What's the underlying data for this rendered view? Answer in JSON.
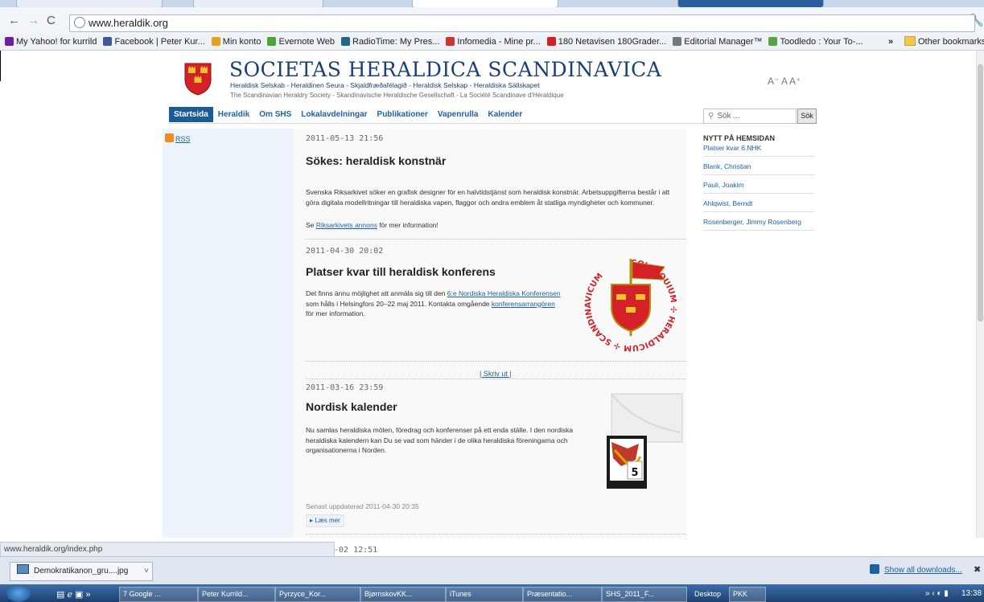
{
  "browser": {
    "url": "www.heraldik.org",
    "bookmarks": [
      {
        "label": "My Yahoo! for kurrild",
        "color": "#6b1fa2"
      },
      {
        "label": "Facebook | Peter Kur...",
        "color": "#3b5998"
      },
      {
        "label": "Min konto",
        "color": "#e8a020"
      },
      {
        "label": "Evernote Web",
        "color": "#4ca33a"
      },
      {
        "label": "RadioTime: My Pres...",
        "color": "#226688"
      },
      {
        "label": "Infomedia - Mine pr...",
        "color": "#cc3333"
      },
      {
        "label": "180 Netavisen 180Grader...",
        "color": "#cc2222"
      },
      {
        "label": "Editorial Manager™",
        "color": "#777777"
      },
      {
        "label": "Toodledo : Your To-...",
        "color": "#5aa34a"
      }
    ],
    "other_bookmarks": "Other bookmarks",
    "status_url": "www.heraldik.org/index.php"
  },
  "site": {
    "title": "SOCIETAS HERALDICA SCANDINAVICA",
    "subtitle_langs": "Heraldisk Selskab - Heraldinen Seura - Skjaldfræðafélagið - Heraldisk Selskap - Heraldiska Sällskapet",
    "subtitle_int": "The Scandinavian Heraldry Society - Skandinavische Heraldische Gesellschaft - La Société Scandinave d'Héraldique",
    "font_controls": "A⁻ A A⁺",
    "nav": [
      "Startsida",
      "Heraldik",
      "Om SHS",
      "Lokalavdelningar",
      "Publikationer",
      "Vapenrulla",
      "Kalender"
    ],
    "search_placeholder": "Sök ...",
    "search_button": "Sök",
    "rss": "RSS"
  },
  "articles": [
    {
      "date": "2011-05-13 21:56",
      "title": "Sökes: heraldisk konstnär",
      "body": "Svenska Riksarkivet söker en grafisk designer för en halvtidstjänst som heraldisk konstnär. Arbetsuppgifterna består i att göra digitala modellritningar till heraldiska vapen, flaggor och andra emblem åt statliga myndigheter och kommuner.",
      "link_pre": "Se ",
      "link": "Riksarkivets annons",
      "link_post": " för mer information!"
    },
    {
      "date": "2011-04-30 20:02",
      "title": "Platser kvar till heraldisk konferens",
      "p1": "Det finns ännu möjlighet att anmäla sig till den ",
      "link1": "6:e Nordiska Heraldiska Konferensen",
      "p2": " som hålls i Helsingfors 20–22 maj 2011. Kontakta omgående ",
      "link2": "konferensarrangören",
      "p3": " för mer information.",
      "logo_text": "COLLOQUIUM ✢ HERALDICUM ✢ SCANDINAVICUM"
    },
    {
      "print": "| Skriv ut |",
      "date": "2011-03-16 23:59",
      "title": "Nordisk kalender",
      "body": "Nu samlas heraldiska möten, föredrag och konferenser på ett enda ställe. I den nordiska heraldiska kalendern kan Du se vad som händer i de olika heraldiska föreningarna och organisationerna i Norden.",
      "calendar_day": "5",
      "updated": "Senast uppdaterad 2011-04-30 20:35",
      "readmore": "▸ Læs mer"
    },
    {
      "date_partial": "-02 12:51"
    }
  ],
  "news": {
    "heading": "NYTT PÅ HEMSIDAN",
    "items": [
      "Platser kvar 6.NHK",
      "Blank, Christian",
      "Pauli, Joakim",
      "Ahlqwist, Berndt",
      "Rosenberger, Jimmy Rosenberg"
    ]
  },
  "downloads": {
    "file": "Demokratikanon_gru....jpg",
    "show_all": "Show all downloads...",
    "close": "✖"
  },
  "taskbar": {
    "items": [
      "7 Google ...",
      "Peter Kurrild...",
      "Pyrzyce_Kor...",
      "BjørnskovKK...",
      "iTunes",
      "Præsentatio...",
      "SHS_2011_F...",
      "Desktop",
      "PKK"
    ],
    "clock": "13:38"
  },
  "colors": {
    "accent": "#1a5b96",
    "link": "#1f5fa6",
    "shield_red": "#d42027",
    "crown_gold": "#f2c12e"
  }
}
